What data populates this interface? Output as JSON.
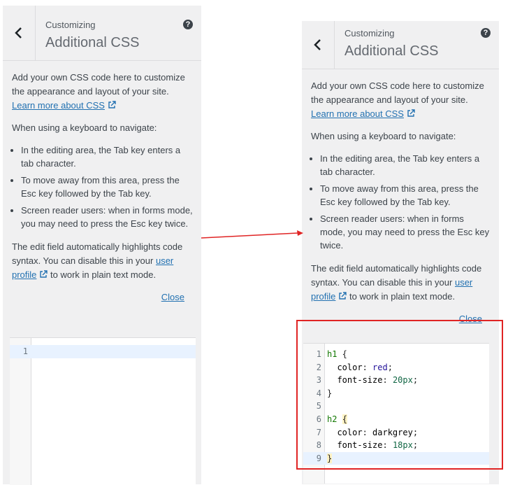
{
  "panels": [
    {
      "breadcrumb": "Customizing",
      "title": "Additional CSS",
      "help_icon": "question-icon",
      "intro": "Add your own CSS code here to customize the appearance and layout of your site.",
      "learn_more": "Learn more about CSS",
      "keyboard_heading": "When using a keyboard to navigate:",
      "bullets": [
        "In the editing area, the Tab key enters a tab character.",
        "To move away from this area, press the Esc key followed by the Tab key.",
        "Screen reader users: when in forms mode, you may need to press the Esc key twice."
      ],
      "syntax_pre": "The edit field automatically highlights code syntax. You can disable this in your ",
      "profile_link": "user profile",
      "syntax_post": " to work in plain text mode.",
      "close": "Close",
      "line_numbers": [
        "1"
      ]
    },
    {
      "breadcrumb": "Customizing",
      "title": "Additional CSS",
      "help_icon": "question-icon",
      "intro": "Add your own CSS code here to customize the appearance and layout of your site.",
      "learn_more": "Learn more about CSS",
      "keyboard_heading": "When using a keyboard to navigate:",
      "bullets": [
        "In the editing area, the Tab key enters a tab character.",
        "To move away from this area, press the Esc key followed by the Tab key.",
        "Screen reader users: when in forms mode, you may need to press the Esc key twice."
      ],
      "syntax_pre": "The edit field automatically highlights code syntax. You can disable this in your ",
      "profile_link": "user profile",
      "syntax_post": " to work in plain text mode.",
      "close": "Close",
      "line_numbers": [
        "1",
        "2",
        "3",
        "4",
        "5",
        "6",
        "7",
        "8",
        "9"
      ],
      "code": {
        "h1": "h1",
        "open1": " {",
        "color": "color",
        "red": "red",
        "fontsize": "font-size",
        "v20": "20px",
        "close1": "}",
        "h2": "h2",
        "brace2": "{",
        "darkgrey": "darkgrey",
        "v18": "18px",
        "close2": "}"
      }
    }
  ],
  "colors": {
    "link": "#2271b1",
    "annotation": "#e02424",
    "active_line": "#e8f2ff"
  }
}
